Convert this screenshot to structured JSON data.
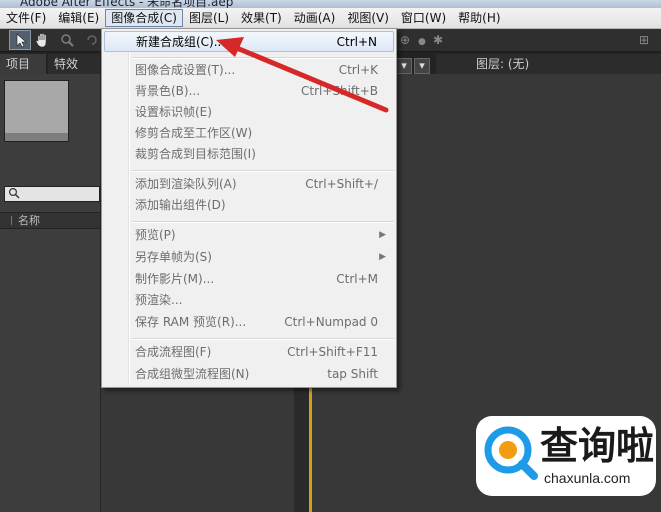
{
  "window": {
    "title": "Adobe After Effects - 未命名项目.aep"
  },
  "menubar": {
    "items": [
      {
        "label": "文件(F)"
      },
      {
        "label": "编辑(E)"
      },
      {
        "label": "图像合成(C)"
      },
      {
        "label": "图层(L)"
      },
      {
        "label": "效果(T)"
      },
      {
        "label": "动画(A)"
      },
      {
        "label": "视图(V)"
      },
      {
        "label": "窗口(W)"
      },
      {
        "label": "帮助(H)"
      }
    ],
    "open_menu": "图像合成(C)"
  },
  "toolbar": {
    "tools": [
      {
        "icon": "selection-arrow-icon",
        "glyph": "➤"
      },
      {
        "icon": "hand-icon",
        "glyph": "✋"
      },
      {
        "icon": "zoom-icon",
        "glyph": "🔍"
      }
    ]
  },
  "panels": {
    "project_tab": "项目",
    "effects_tab": "特效",
    "layer_tab": "图层: (无)",
    "column_name": "名称"
  },
  "dropdown": {
    "items": [
      {
        "label": "新建合成组(C)...",
        "shortcut": "Ctrl+N",
        "enabled": true,
        "highlighted": true
      },
      {
        "separator": true
      },
      {
        "label": "图像合成设置(T)...",
        "shortcut": "Ctrl+K",
        "enabled": false
      },
      {
        "label": "背景色(B)...",
        "shortcut": "Ctrl+Shift+B",
        "enabled": false
      },
      {
        "label": "设置标识帧(E)",
        "shortcut": "",
        "enabled": false
      },
      {
        "label": "修剪合成至工作区(W)",
        "shortcut": "",
        "enabled": false
      },
      {
        "label": "裁剪合成到目标范围(I)",
        "shortcut": "",
        "enabled": false
      },
      {
        "separator": true
      },
      {
        "label": "添加到渲染队列(A)",
        "shortcut": "Ctrl+Shift+/",
        "enabled": false
      },
      {
        "label": "添加输出组件(D)",
        "shortcut": "",
        "enabled": false
      },
      {
        "separator": true
      },
      {
        "label": "预览(P)",
        "shortcut": "",
        "enabled": false,
        "submenu": true
      },
      {
        "label": "另存单帧为(S)",
        "shortcut": "",
        "enabled": false,
        "submenu": true
      },
      {
        "label": "制作影片(M)...",
        "shortcut": "Ctrl+M",
        "enabled": false
      },
      {
        "label": "预渲染...",
        "shortcut": "",
        "enabled": false
      },
      {
        "label": "保存 RAM 预览(R)...",
        "shortcut": "Ctrl+Numpad 0",
        "enabled": false
      },
      {
        "separator": true
      },
      {
        "label": "合成流程图(F)",
        "shortcut": "Ctrl+Shift+F11",
        "enabled": false
      },
      {
        "label": "合成组微型流程图(N)",
        "shortcut": "tap Shift",
        "enabled": false
      }
    ]
  },
  "annotation": {
    "color": "#d62828"
  },
  "watermark": {
    "text_cn": "查询啦",
    "text_en": "chaxunla.com",
    "accent": "#1e9be8"
  }
}
